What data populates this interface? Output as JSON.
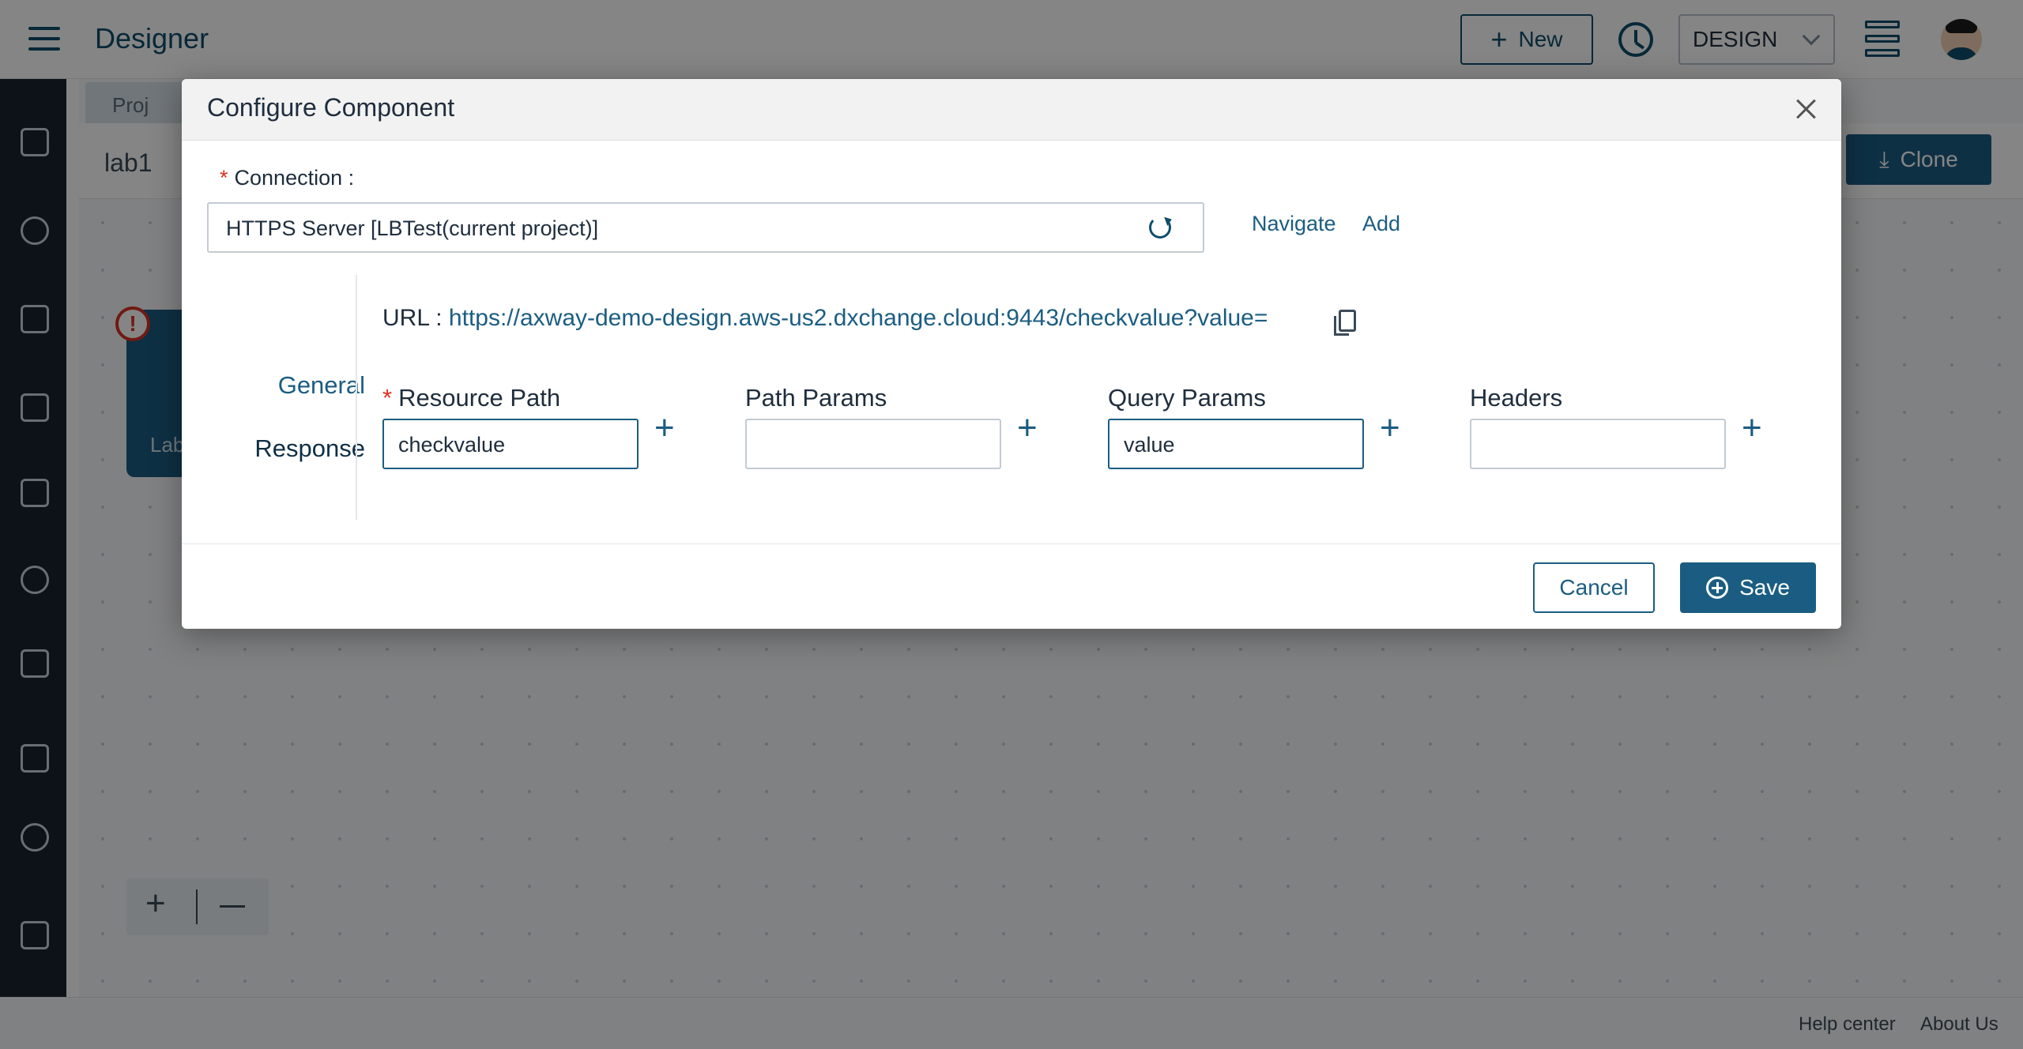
{
  "app": {
    "title": "Designer",
    "new_label": "New",
    "mode_value": "DESIGN"
  },
  "workspace": {
    "tab_label": "Proj",
    "project_title": "lab1",
    "clone_label": "Clone",
    "node_label": "Lab",
    "error_glyph": "!"
  },
  "footer": {
    "help_center": "Help center",
    "about_us": "About Us"
  },
  "modal": {
    "title": "Configure Component",
    "connection": {
      "label": "Connection :",
      "required_mark": "*",
      "value": "HTTPS Server [LBTest(current project)]",
      "navigate_label": "Navigate",
      "add_label": "Add"
    },
    "tabs": [
      {
        "label": "General"
      },
      {
        "label": "Response"
      }
    ],
    "url": {
      "label": "URL :",
      "value": "https://axway-demo-design.aws-us2.dxchange.cloud:9443/checkvalue?value="
    },
    "params": [
      {
        "label": "Resource Path",
        "required": "*",
        "value": "checkvalue"
      },
      {
        "label": "Path Params",
        "value": ""
      },
      {
        "label": "Query Params",
        "value": "value"
      },
      {
        "label": "Headers",
        "value": ""
      }
    ],
    "plus_glyph": "+",
    "cancel_label": "Cancel",
    "save_label": "Save"
  }
}
